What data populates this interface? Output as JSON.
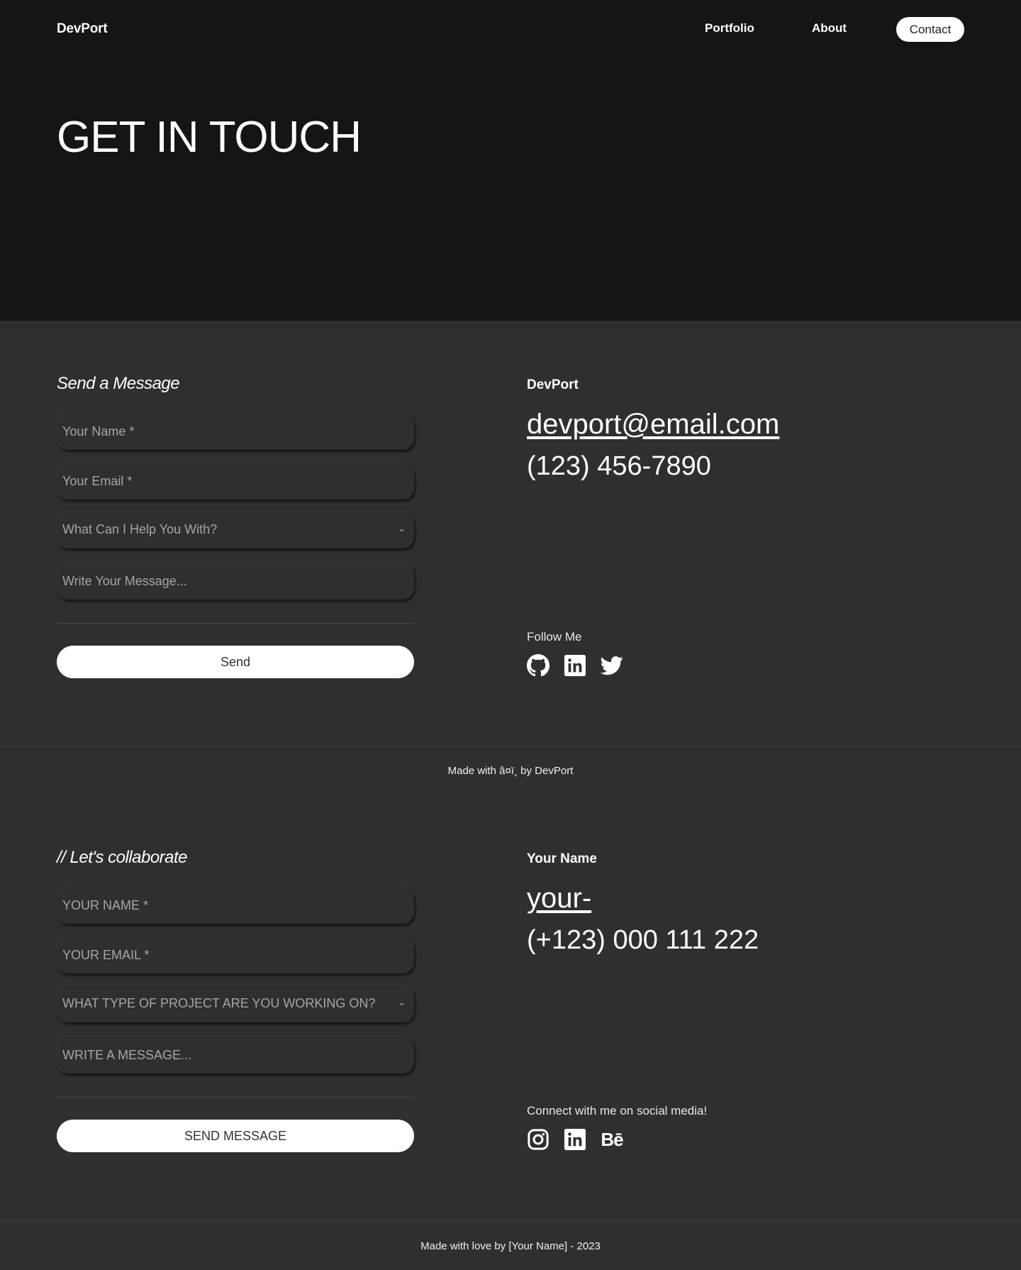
{
  "nav": {
    "brand": "DevPort",
    "links": [
      "Portfolio",
      "About"
    ],
    "contact": "Contact"
  },
  "hero": {
    "title": "GET IN TOUCH"
  },
  "section1": {
    "form": {
      "heading": "Send a Message",
      "name_placeholder": "Your Name *",
      "email_placeholder": "Your Email *",
      "select_value": "What Can I Help You With?",
      "message_placeholder": "Write Your Message...",
      "submit": "Send"
    },
    "info": {
      "name": "DevPort",
      "email": "devport@email.com",
      "phone": "(123) 456-7890",
      "follow_label": "Follow Me",
      "social_icons": [
        "github-icon",
        "linkedin-icon",
        "twitter-icon"
      ]
    },
    "footer": "Made with â¤ï¸ by DevPort"
  },
  "section2": {
    "form": {
      "heading": "// Let's collaborate",
      "name_placeholder": "YOUR NAME *",
      "email_placeholder": "YOUR EMAIL *",
      "select_value": "WHAT TYPE OF PROJECT ARE YOU WORKING ON?",
      "message_placeholder": "WRITE A MESSAGE...",
      "submit": "SEND MESSAGE"
    },
    "info": {
      "name": "Your Name",
      "email": "your-",
      "phone": "(+123) 000 111 222",
      "follow_label": "Connect with me on social media!",
      "social_icons": [
        "instagram-icon",
        "linkedin-icon",
        "behance-icon"
      ],
      "behance_glyph": "Bē"
    },
    "footer": "Made with love by [Your Name] - 2023"
  },
  "colors": {
    "hero_bg": "#151515",
    "section_bg": "#2f2f2f",
    "button_bg": "#ffffff",
    "text": "#ffffff",
    "placeholder": "#a5a5a5"
  }
}
